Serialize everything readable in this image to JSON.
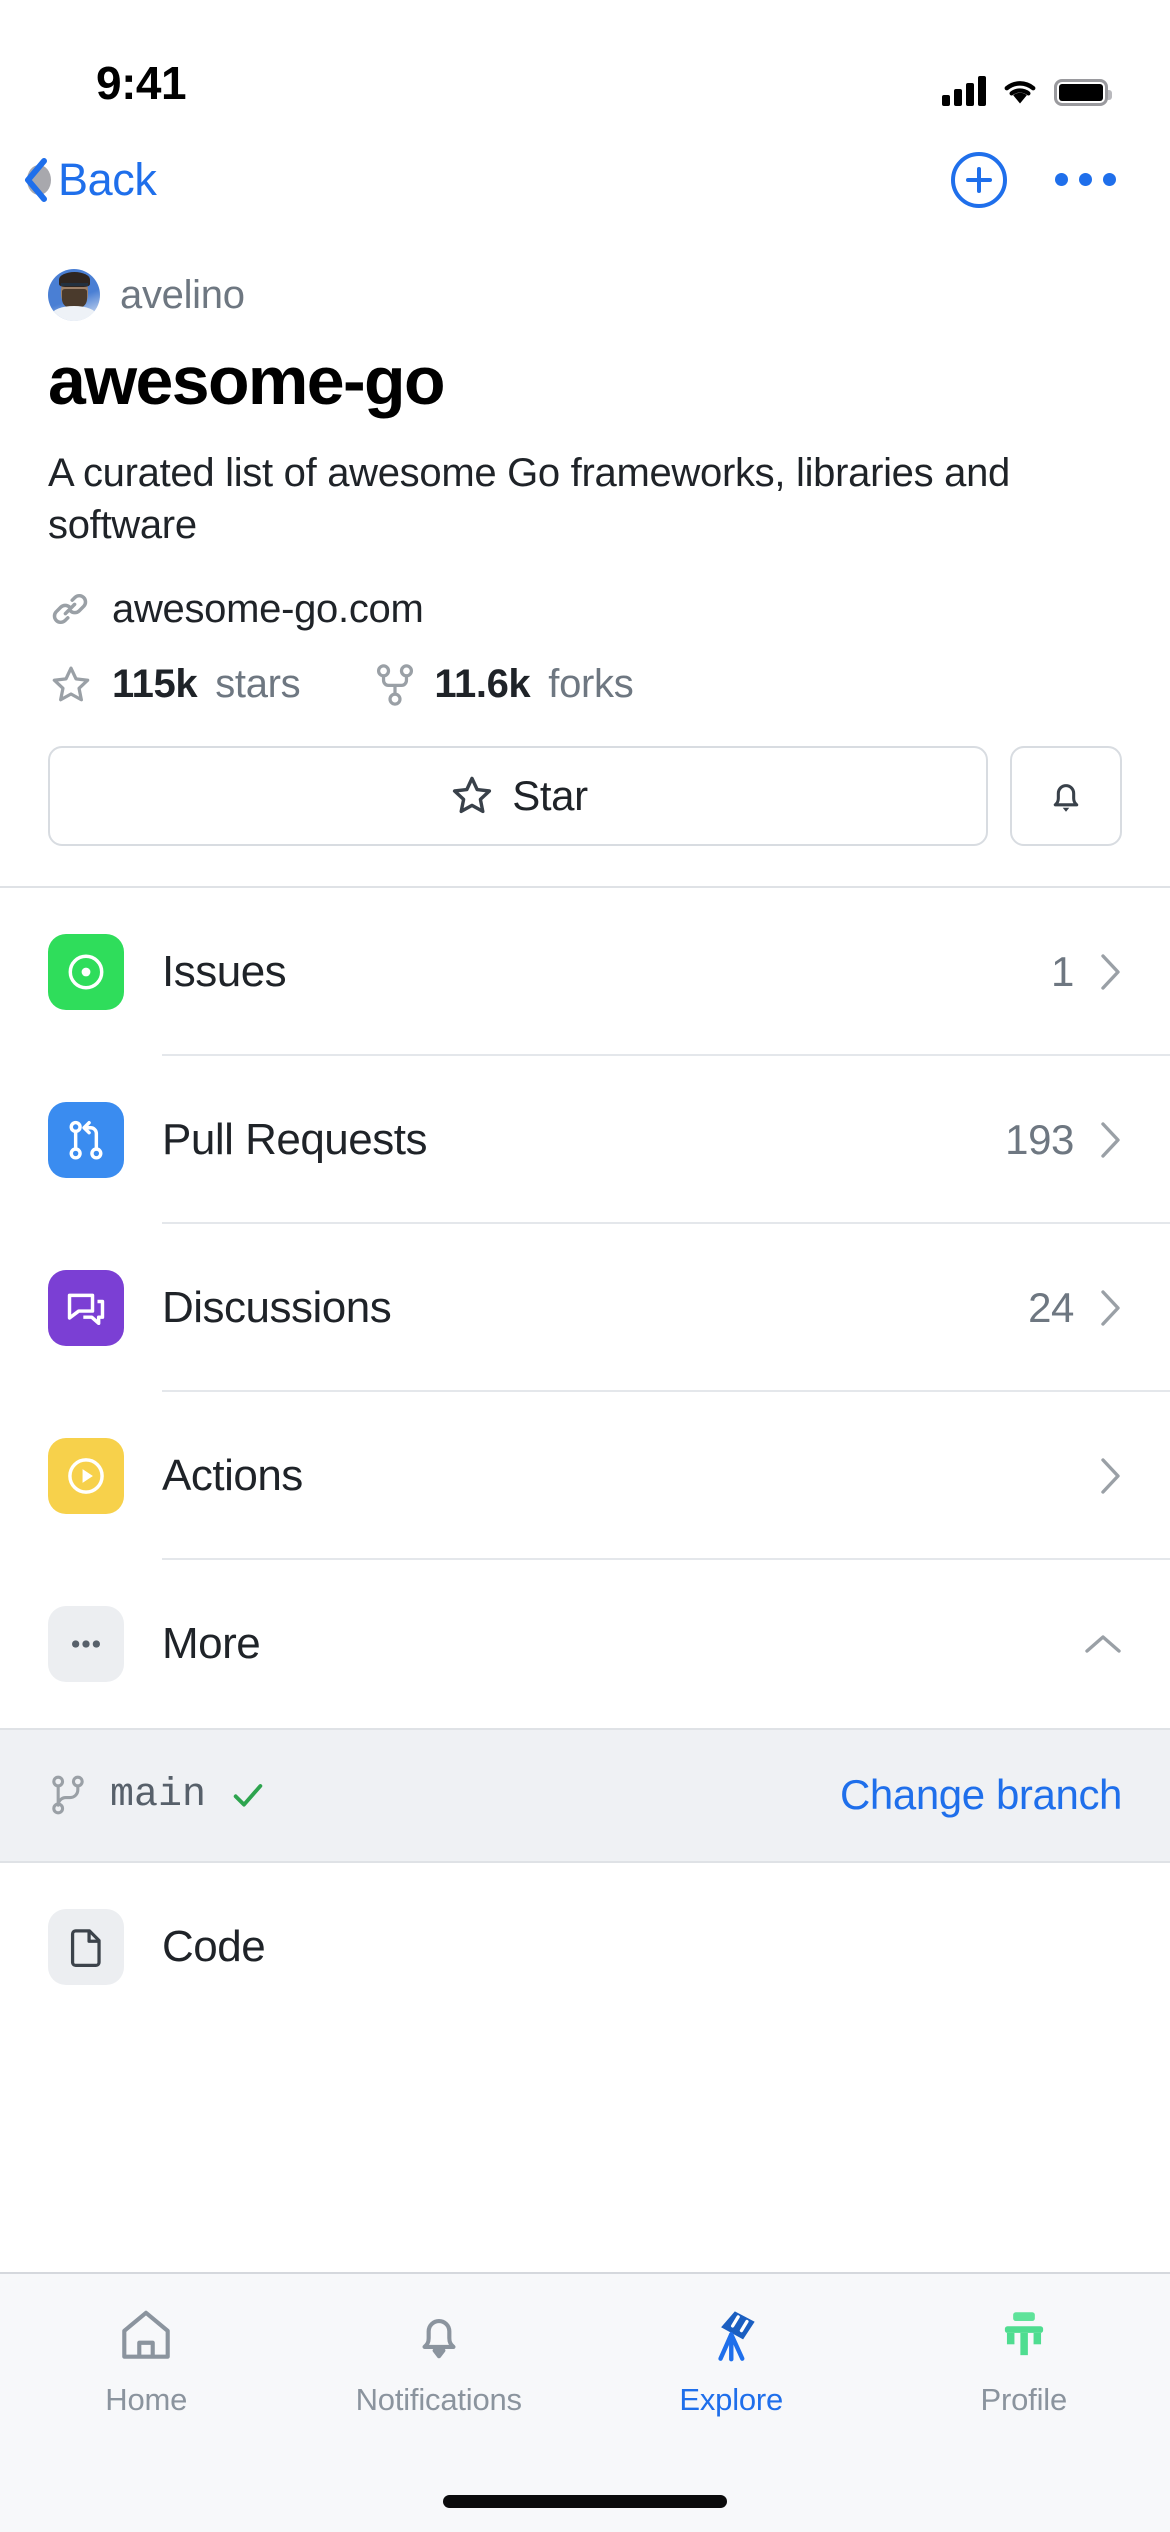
{
  "status_bar": {
    "time": "9:41",
    "cellular_icon": "signal-bars-icon",
    "wifi_icon": "wifi-icon",
    "battery_icon": "battery-full-icon"
  },
  "nav_bar": {
    "back_label": "Back",
    "back_icon": "chevron-left-icon",
    "add_icon": "plus-circle-icon",
    "more_icon": "ellipsis-icon",
    "accent_color": "#1f6feb"
  },
  "repo": {
    "owner": "avelino",
    "owner_avatar_icon": "avatar",
    "name": "awesome-go",
    "description": "A curated list of awesome Go frameworks, libraries and software",
    "homepage": "awesome-go.com",
    "homepage_icon": "link-icon",
    "stars_count": "115k",
    "stars_label": "stars",
    "stars_icon": "star-icon",
    "forks_count": "11.6k",
    "forks_label": "forks",
    "forks_icon": "repo-forked-icon"
  },
  "actions": {
    "star_label": "Star",
    "star_icon": "star-icon",
    "watch_icon": "bell-icon"
  },
  "menu": {
    "items": [
      {
        "label": "Issues",
        "count": "1",
        "icon": "issue-opened-icon",
        "icon_bg": "#2fdd5b",
        "chevron": "chevron-right-icon"
      },
      {
        "label": "Pull Requests",
        "count": "193",
        "icon": "git-pull-request-icon",
        "icon_bg": "#3a8cf0",
        "chevron": "chevron-right-icon"
      },
      {
        "label": "Discussions",
        "count": "24",
        "icon": "comment-discussion-icon",
        "icon_bg": "#7b3fd4",
        "chevron": "chevron-right-icon"
      },
      {
        "label": "Actions",
        "count": "",
        "icon": "play-circle-icon",
        "icon_bg": "#f7d14b",
        "chevron": "chevron-right-icon"
      },
      {
        "label": "More",
        "count": "",
        "icon": "ellipsis-icon",
        "icon_bg": "#eceef1",
        "chevron": "chevron-up-icon"
      }
    ]
  },
  "branch_bar": {
    "branch_icon": "git-branch-icon",
    "branch_name": "main",
    "check_icon": "check-icon",
    "check_color": "#2da44e",
    "change_label": "Change branch"
  },
  "code_row": {
    "label": "Code",
    "icon": "file-code-icon"
  },
  "tab_bar": {
    "tabs": [
      {
        "label": "Home",
        "icon": "home-icon",
        "active": false
      },
      {
        "label": "Notifications",
        "icon": "bell-icon",
        "active": false
      },
      {
        "label": "Explore",
        "icon": "telescope-icon",
        "active": true
      },
      {
        "label": "Profile",
        "icon": "profile-icon",
        "active": false
      }
    ],
    "active_color": "#1f6feb",
    "inactive_color": "#8b949e"
  }
}
